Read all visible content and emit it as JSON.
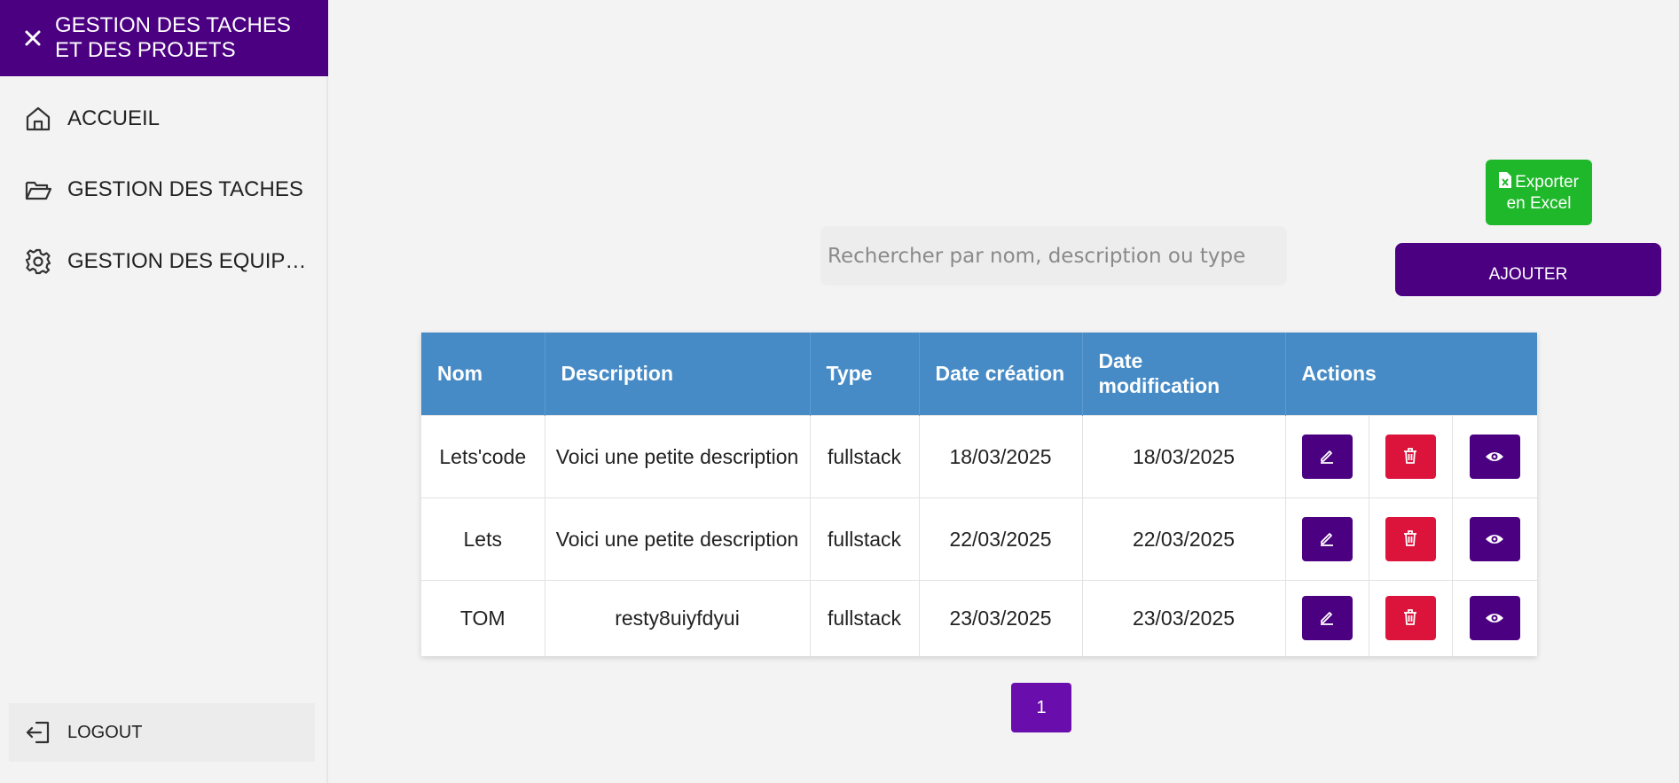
{
  "sidebar": {
    "title": "GESTION DES TACHES ET DES PROJETS",
    "close_icon": "close-icon",
    "items": [
      {
        "label": "ACCUEIL",
        "icon": "home-icon"
      },
      {
        "label": "GESTION DES TACHES",
        "icon": "folder-open-icon"
      },
      {
        "label": "GESTION DES EQUIPES",
        "icon": "gear-icon"
      }
    ],
    "logout": {
      "label": "LOGOUT",
      "icon": "logout-icon"
    }
  },
  "toolbar": {
    "export_line1": "Exporter",
    "export_line2": "en Excel",
    "search_placeholder": "Rechercher par nom, description ou type",
    "add_label": "AJOUTER"
  },
  "table": {
    "headers": {
      "nom": "Nom",
      "description": "Description",
      "type": "Type",
      "date_creation": "Date création",
      "date_modification": "Date modification",
      "actions": "Actions"
    },
    "rows": [
      {
        "nom": "Lets'code",
        "description": "Voici une petite description",
        "type": "fullstack",
        "date_creation": "18/03/2025",
        "date_modification": "18/03/2025"
      },
      {
        "nom": "Lets",
        "description": "Voici une petite description",
        "type": "fullstack",
        "date_creation": "22/03/2025",
        "date_modification": "22/03/2025"
      },
      {
        "nom": "TOM",
        "description": "resty8uiyfdyui",
        "type": "fullstack",
        "date_creation": "23/03/2025",
        "date_modification": "23/03/2025"
      }
    ]
  },
  "pagination": {
    "current": "1"
  },
  "colors": {
    "primary": "#4b0082",
    "header_blue": "#468bc6",
    "export_green": "#1fb82a",
    "delete_red": "#dc143c",
    "page_purple": "#6a0dad"
  }
}
